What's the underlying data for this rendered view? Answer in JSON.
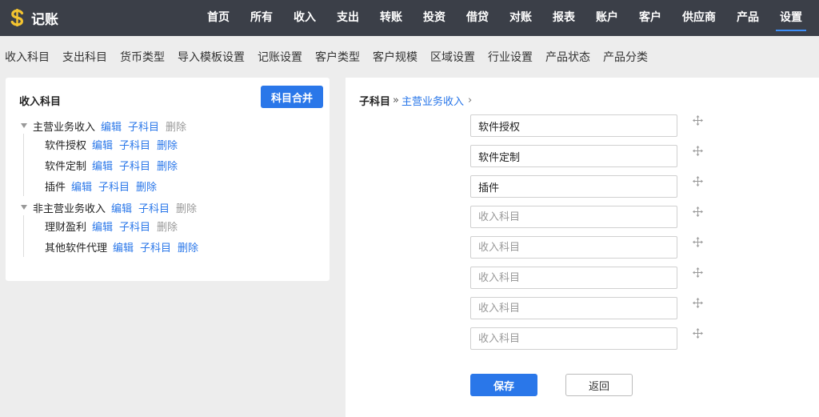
{
  "app": {
    "title": "记账",
    "accent": "#2a77e9",
    "topbar_bg": "#3b3f48"
  },
  "nav": {
    "items": [
      {
        "label": "首页"
      },
      {
        "label": "所有"
      },
      {
        "label": "收入"
      },
      {
        "label": "支出"
      },
      {
        "label": "转账"
      },
      {
        "label": "投资"
      },
      {
        "label": "借贷"
      },
      {
        "label": "对账"
      },
      {
        "label": "报表"
      },
      {
        "label": "账户"
      },
      {
        "label": "客户"
      },
      {
        "label": "供应商"
      },
      {
        "label": "产品"
      },
      {
        "label": "设置"
      }
    ],
    "active": "设置"
  },
  "subnav": {
    "items": [
      {
        "label": "收入科目"
      },
      {
        "label": "支出科目"
      },
      {
        "label": "货币类型"
      },
      {
        "label": "导入模板设置"
      },
      {
        "label": "记账设置"
      },
      {
        "label": "客户类型"
      },
      {
        "label": "客户规模"
      },
      {
        "label": "区域设置"
      },
      {
        "label": "行业设置"
      },
      {
        "label": "产品状态"
      },
      {
        "label": "产品分类"
      }
    ]
  },
  "left_panel": {
    "title": "收入科目",
    "merge_button": "科目合并",
    "actions": {
      "edit": "编辑",
      "sub": "子科目",
      "delete": "删除"
    },
    "groups": [
      {
        "name": "主营业务收入",
        "children": [
          {
            "name": "软件授权"
          },
          {
            "name": "软件定制"
          },
          {
            "name": "插件"
          }
        ]
      },
      {
        "name": "非主营业务收入",
        "children": [
          {
            "name": "理财盈利"
          },
          {
            "name": "其他软件代理"
          }
        ]
      }
    ]
  },
  "right_panel": {
    "breadcrumb_root": "子科目",
    "breadcrumb_sep": "»",
    "breadcrumb_current": "主营业务收入",
    "breadcrumb_chevron": "›",
    "fields": [
      {
        "value": "软件授权",
        "placeholder": "收入科目"
      },
      {
        "value": "软件定制",
        "placeholder": "收入科目"
      },
      {
        "value": "插件",
        "placeholder": "收入科目"
      },
      {
        "value": "",
        "placeholder": "收入科目"
      },
      {
        "value": "",
        "placeholder": "收入科目"
      },
      {
        "value": "",
        "placeholder": "收入科目"
      },
      {
        "value": "",
        "placeholder": "收入科目"
      },
      {
        "value": "",
        "placeholder": "收入科目"
      }
    ],
    "save_label": "保存",
    "back_label": "返回"
  }
}
